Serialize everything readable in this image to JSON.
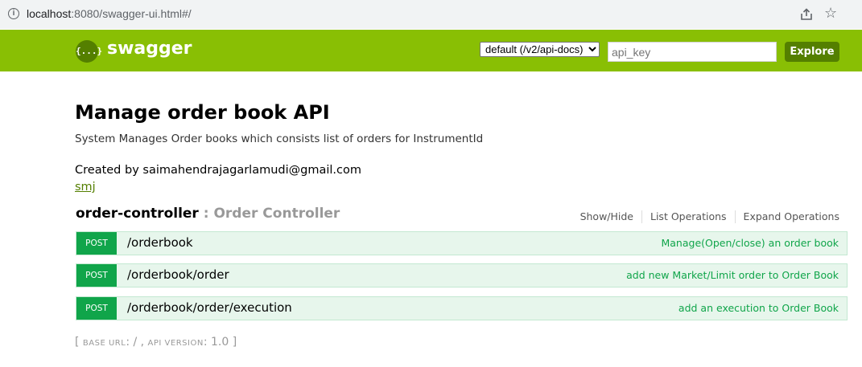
{
  "browser": {
    "url_host": "localhost",
    "url_rest": ":8080/swagger-ui.html#/",
    "info_icon": "info-icon",
    "share_icon": "share-icon",
    "star_icon": "star-icon"
  },
  "header": {
    "logo_mark": "{...}",
    "logo_text": "swagger",
    "spec_selected": "default (/v2/api-docs)",
    "api_key_placeholder": "api_key",
    "explore_label": "Explore",
    "colors": {
      "bar": "#89bf04",
      "dark": "#547f00"
    }
  },
  "info": {
    "title": "Manage order book API",
    "description": "System Manages Order books which consists list of orders for InstrumentId",
    "created_by": "Created by saimahendrajagarlamudi@gmail.com",
    "license": "smj"
  },
  "resource": {
    "name": "order-controller",
    "separator": " : ",
    "description": "Order Controller",
    "actions": [
      "Show/Hide",
      "List Operations",
      "Expand Operations"
    ]
  },
  "operations": [
    {
      "method": "POST",
      "path": "/orderbook",
      "summary": "Manage(Open/close) an order book"
    },
    {
      "method": "POST",
      "path": "/orderbook/order",
      "summary": "add new Market/Limit order to Order Book"
    },
    {
      "method": "POST",
      "path": "/orderbook/order/execution",
      "summary": "add an execution to Order Book"
    }
  ],
  "footer": {
    "open": "[ ",
    "base_url_label": "BASE URL",
    "base_url_value": ": / , ",
    "api_version_label": "API VERSION",
    "api_version_value": ": 1.0 ]"
  }
}
